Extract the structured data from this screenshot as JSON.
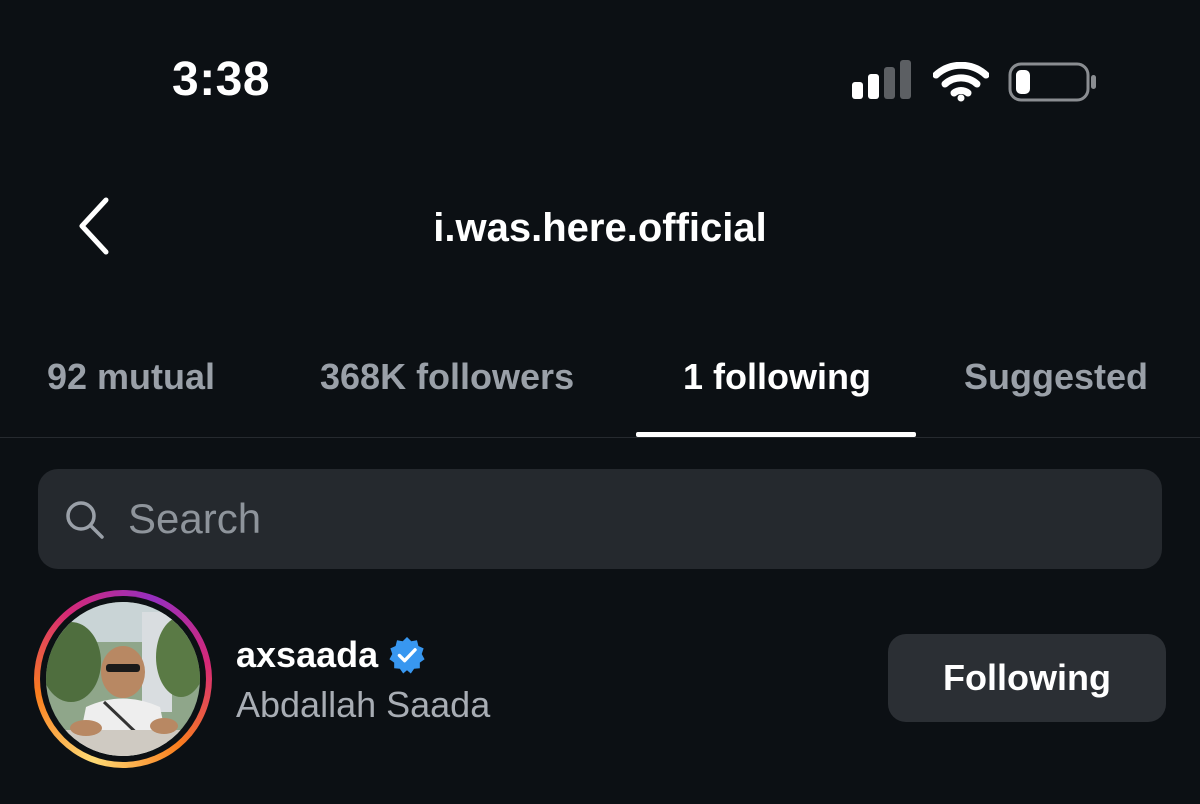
{
  "status_bar": {
    "time": "3:38",
    "signal_icon": "cellular-signal-icon",
    "wifi_icon": "wifi-icon",
    "battery_icon": "battery-icon"
  },
  "header": {
    "back_icon": "chevron-left-icon",
    "title": "i.was.here.official"
  },
  "tabs": [
    {
      "label": "92 mutual",
      "active": false
    },
    {
      "label": "368K followers",
      "active": false
    },
    {
      "label": "1 following",
      "active": true
    },
    {
      "label": "Suggested",
      "active": false
    }
  ],
  "search": {
    "icon": "search-icon",
    "placeholder": "Search",
    "value": ""
  },
  "following_list": [
    {
      "username": "axsaada",
      "verified": true,
      "full_name": "Abdallah Saada",
      "button_label": "Following"
    }
  ],
  "colors": {
    "background": "#0c1014",
    "search_bg": "#25292e",
    "button_bg": "#2b2f34",
    "muted_text": "#9aa0a8",
    "verified_blue": "#3897f0"
  }
}
